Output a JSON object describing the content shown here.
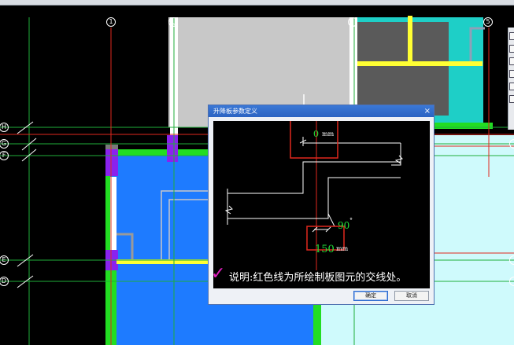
{
  "axes": {
    "columns": [
      "1",
      "5"
    ],
    "rows": [
      "H",
      "G",
      "F",
      "E",
      "D"
    ]
  },
  "dialog": {
    "title": "升降板参数定义",
    "close": "×",
    "top_value": "0",
    "top_unit": "mm",
    "angle_value": "90",
    "angle_unit": "°",
    "bottom_value": "150",
    "bottom_unit": "mm",
    "note": "说明:红色线为所绘制板图元的交线处。",
    "check_mark": "✓",
    "ok_label": "确定",
    "cancel_label": "取消"
  },
  "colors": {
    "accent_red": "#e0281e",
    "value_green": "#22e33a",
    "annotation_magenta": "#e11fbf"
  }
}
